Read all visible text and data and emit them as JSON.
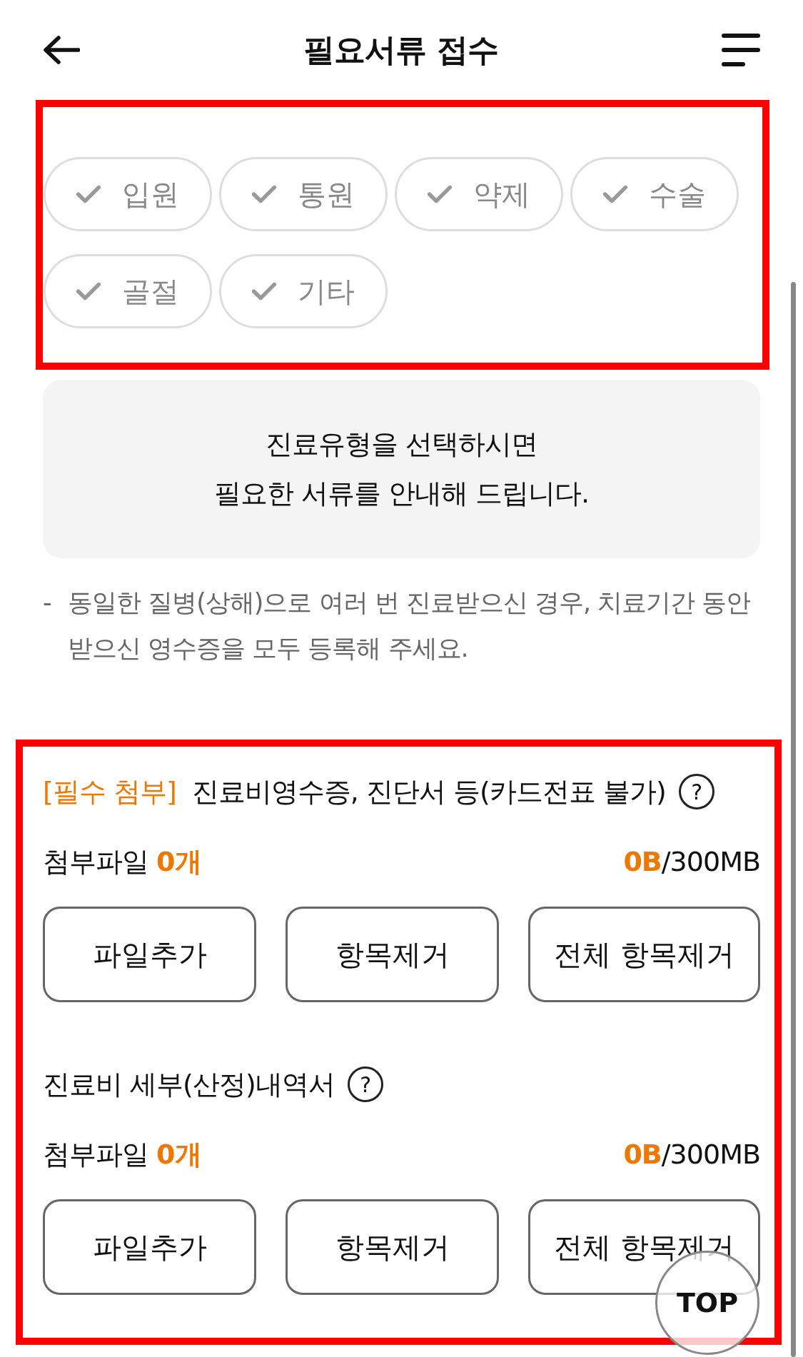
{
  "header": {
    "title": "필요서류 접수"
  },
  "categories": [
    {
      "label": "입원",
      "checked": false
    },
    {
      "label": "통원",
      "checked": false
    },
    {
      "label": "약제",
      "checked": false
    },
    {
      "label": "수술",
      "checked": false
    },
    {
      "label": "골절",
      "checked": false
    },
    {
      "label": "기타",
      "checked": false
    }
  ],
  "info": {
    "lines": [
      "진료유형을 선택하시면",
      "필요한 서류를 안내해 드립니다."
    ]
  },
  "notes": [
    {
      "bullet": "-",
      "text": "동일한 질병(상해)으로 여러 번 진료받으신 경우, 치료기간 동안 받으신 영수증을 모두 등록해 주세요."
    }
  ],
  "attachments": [
    {
      "tag": "[필수 첨부]",
      "title": "진료비영수증, 진단서 등(카드전표 불가)",
      "help": "?",
      "count_label": "첨부파일",
      "count": "0개",
      "size_used": "0B",
      "size_limit": "/300MB",
      "buttons": [
        "파일추가",
        "항목제거",
        "전체 항목제거"
      ]
    },
    {
      "title": "진료비 세부(산정)내역서",
      "help": "?",
      "count_label": "첨부파일",
      "count": "0개",
      "size_used": "0B",
      "size_limit": "/300MB",
      "buttons": [
        "파일추가",
        "항목제거",
        "전체 항목제거"
      ]
    }
  ],
  "top_button": {
    "label": "TOP"
  }
}
